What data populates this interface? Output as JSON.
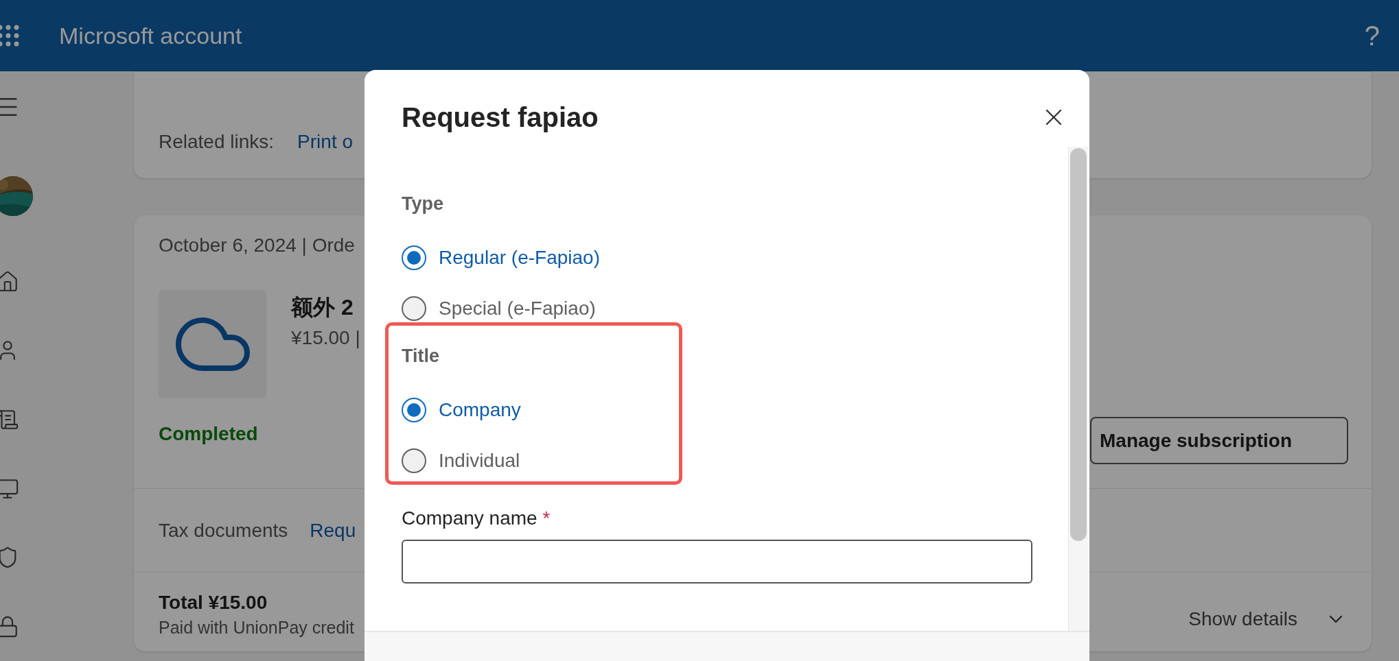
{
  "header": {
    "title": "Microsoft account",
    "help": "?"
  },
  "related": {
    "label": "Related links:",
    "link": "Print o"
  },
  "order": {
    "heading": "October 6, 2024 | Orde",
    "product_name": "额外 2",
    "price": "¥15.00 |",
    "status": "Completed",
    "manage_button": "Manage subscription",
    "tax_label": "Tax documents",
    "tax_link": "Requ",
    "total": "Total ¥15.00",
    "payment": "Paid with UnionPay credit",
    "show_details": "Show details"
  },
  "dialog": {
    "title": "Request fapiao",
    "groups": [
      {
        "label": "Type",
        "highlighted": false,
        "options": [
          {
            "label": "Regular (e-Fapiao)",
            "selected": true
          },
          {
            "label": "Special (e-Fapiao)",
            "selected": false
          }
        ]
      },
      {
        "label": "Title",
        "highlighted": true,
        "options": [
          {
            "label": "Company",
            "selected": true
          },
          {
            "label": "Individual",
            "selected": false
          }
        ]
      }
    ],
    "fields": [
      {
        "label": "Company name",
        "required_mark": "*"
      }
    ]
  }
}
